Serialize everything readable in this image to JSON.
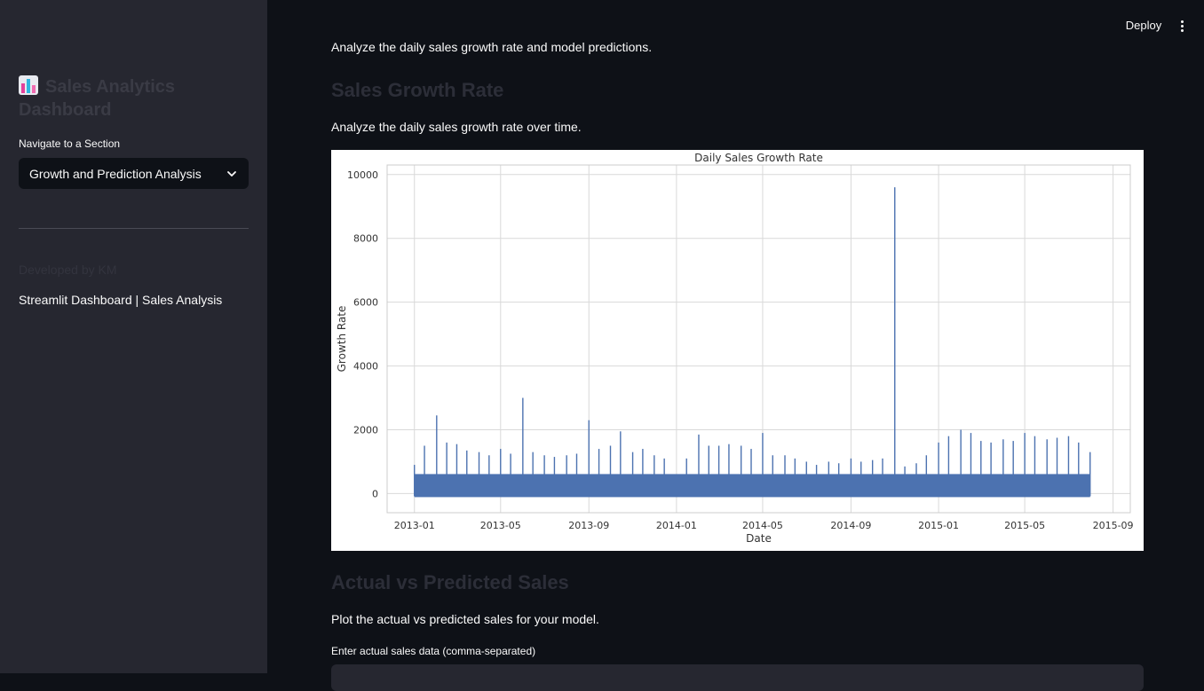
{
  "sidebar": {
    "title": "Sales Analytics Dashboard",
    "nav_label": "Navigate to a Section",
    "selected_section": "Growth and Prediction Analysis",
    "developed_by": "Developed by KM",
    "footer": "Streamlit Dashboard | Sales Analysis"
  },
  "topbar": {
    "deploy_label": "Deploy",
    "menu_icon": "kebab-menu-icon"
  },
  "main": {
    "intro": "Analyze the daily sales growth rate and model predictions.",
    "growth_heading": "Sales Growth Rate",
    "growth_desc": "Analyze the daily sales growth rate over time.",
    "actual_heading": "Actual vs Predicted Sales",
    "actual_desc": "Plot the actual vs predicted sales for your model.",
    "input_label": "Enter actual sales data (comma-separated)"
  },
  "colors": {
    "line": "#4c72b0",
    "sidebar_bg": "#262730",
    "main_bg": "#0e1117"
  },
  "chart_data": {
    "type": "line",
    "title": "Daily Sales Growth Rate",
    "xlabel": "Date",
    "ylabel": "Growth Rate",
    "x_ticks": [
      "2013-01",
      "2013-05",
      "2013-09",
      "2014-01",
      "2014-05",
      "2014-09",
      "2015-01",
      "2015-05",
      "2015-09"
    ],
    "y_ticks": [
      0,
      2000,
      4000,
      6000,
      8000,
      10000
    ],
    "xlim": [
      "2012-11-24",
      "2015-09-25"
    ],
    "ylim": [
      -600,
      10300
    ],
    "grid": true,
    "series": [
      {
        "values_note": "",
        "x": [
          "2013-01-01",
          "2013-01-15",
          "2013-02-01",
          "2013-02-15",
          "2013-03-01",
          "2013-03-15",
          "2013-04-01",
          "2013-04-15",
          "2013-05-01",
          "2013-05-15",
          "2013-06-01",
          "2013-06-15",
          "2013-07-01",
          "2013-07-15",
          "2013-08-01",
          "2013-08-15",
          "2013-09-01",
          "2013-09-15",
          "2013-10-01",
          "2013-10-15",
          "2013-11-01",
          "2013-11-15",
          "2013-12-01",
          "2013-12-15",
          "2014-01-01",
          "2014-01-15",
          "2014-02-01",
          "2014-02-15",
          "2014-03-01",
          "2014-03-15",
          "2014-04-01",
          "2014-04-15",
          "2014-05-01",
          "2014-05-15",
          "2014-06-01",
          "2014-06-15",
          "2014-07-01",
          "2014-07-15",
          "2014-08-01",
          "2014-08-15",
          "2014-09-01",
          "2014-09-15",
          "2014-10-01",
          "2014-10-15",
          "2014-11-01",
          "2014-11-15",
          "2014-12-01",
          "2014-12-15",
          "2015-01-01",
          "2015-01-15",
          "2015-02-01",
          "2015-02-15",
          "2015-03-01",
          "2015-03-15",
          "2015-04-01",
          "2015-04-15",
          "2015-05-01",
          "2015-05-15",
          "2015-06-01",
          "2015-06-15",
          "2015-07-01",
          "2015-07-15",
          "2015-07-31"
        ],
        "values": [
          900,
          1500,
          2450,
          1600,
          1550,
          1350,
          1300,
          1200,
          1400,
          1250,
          3000,
          1300,
          1200,
          1150,
          1200,
          1250,
          2300,
          1400,
          1500,
          1950,
          1300,
          1400,
          1200,
          1100,
          0,
          1100,
          1850,
          1500,
          1500,
          1550,
          1500,
          1400,
          1900,
          1200,
          1200,
          1100,
          1000,
          900,
          1000,
          950,
          1100,
          1000,
          1050,
          1100,
          9600,
          850,
          950,
          1200,
          1600,
          1800,
          2000,
          1900,
          1650,
          1600,
          1700,
          1650,
          1900,
          1800,
          1700,
          1750,
          1800,
          1600,
          1300
        ]
      }
    ]
  }
}
